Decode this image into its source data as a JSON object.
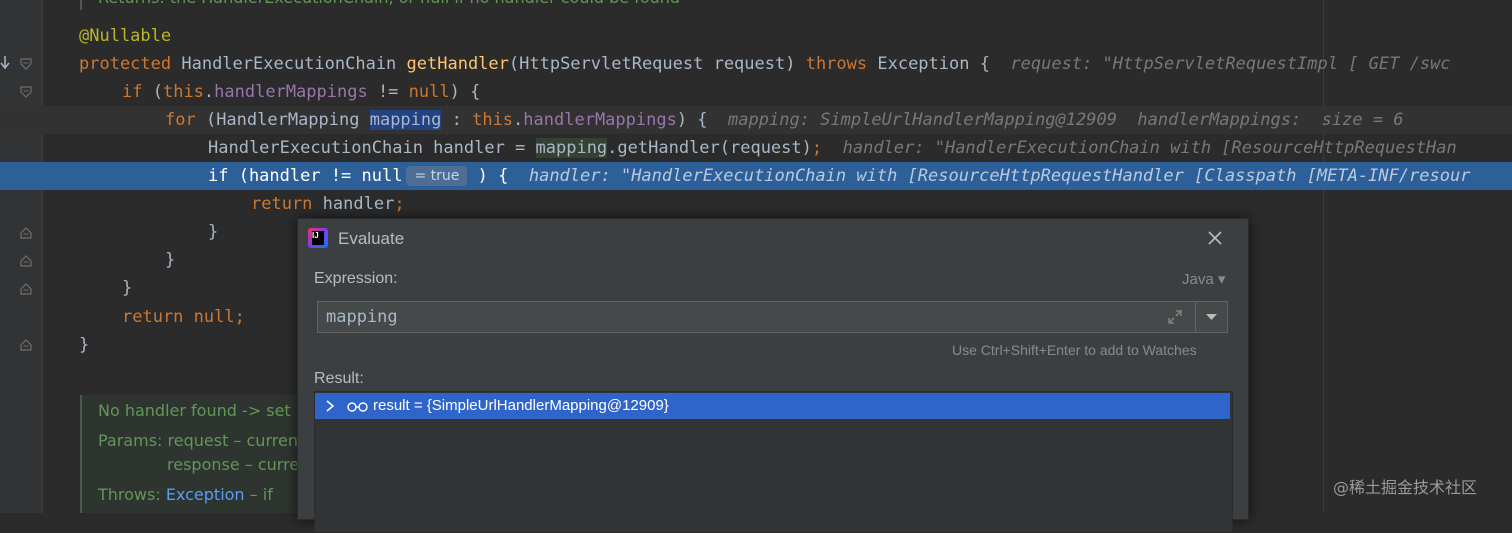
{
  "editor": {
    "top_doc": "Returns: the HandlerExecutionChain, or null if no handler could be found",
    "line_annotation": "@Nullable",
    "line_method": {
      "k1": "protected",
      "t1": " HandlerExecutionChain ",
      "m": "getHandler",
      "t2": "(HttpServletRequest request) ",
      "k2": "throws",
      "t3": " Exception {",
      "hint": "request: \"HttpServletRequestImpl [ GET /swc"
    },
    "line_if": {
      "k1": "if",
      "t1": " (",
      "f1": "this",
      "t2": ".",
      "f2": "handlerMappings",
      "t3": " != ",
      "k2": "null",
      "t4": ") {"
    },
    "line_for": {
      "k1": "for",
      "t1": " (HandlerMapping ",
      "sel": "mapping",
      "t2": " : ",
      "f0": "this",
      "t3": ".",
      "f1": "handlerMappings",
      "t4": ") {",
      "hint": "mapping: SimpleUrlHandlerMapping@12909  handlerMappings:  size = 6"
    },
    "line_handler": {
      "t1": "HandlerExecutionChain handler = ",
      "hl": "mapping",
      "t2": ".getHandler(request)",
      "k1": ";",
      "hint": "handler: \"HandlerExecutionChain with [ResourceHttpRequestHan"
    },
    "line_exec": {
      "t1": "if (handler != null",
      "badge": "= true",
      "t2": ") {",
      "hint": "handler: \"HandlerExecutionChain with [ResourceHttpRequestHandler [Classpath [META-INF/resour"
    },
    "line_return": {
      "k1": "return",
      "t1": " handler",
      "k2": ";"
    },
    "brace1": "}",
    "brace2": "}",
    "brace3": "}",
    "line_return_null": {
      "k1": "return",
      "t1": " ",
      "k2": "null",
      "t2": ";"
    },
    "brace4": "}",
    "doc": {
      "l1": "No handler found -> set",
      "l2": "Params: request – curren",
      "l3": "response – curre",
      "l4_pre": "Throws: ",
      "l4_link": "Exception",
      "l4_post": " – if"
    }
  },
  "dialog": {
    "title": "Evaluate",
    "expression_label": "Expression:",
    "language": "Java ▾",
    "expression_value": "mapping",
    "watch_hint": "Use Ctrl+Shift+Enter to add to Watches",
    "result_label": "Result:",
    "result_text": "result = {SimpleUrlHandlerMapping@12909}"
  },
  "watermark": "@稀土掘金技术社区",
  "colors": {
    "exec_line": "#2d6099",
    "result_selected": "#2f65ca",
    "keyword": "#cc7832"
  }
}
